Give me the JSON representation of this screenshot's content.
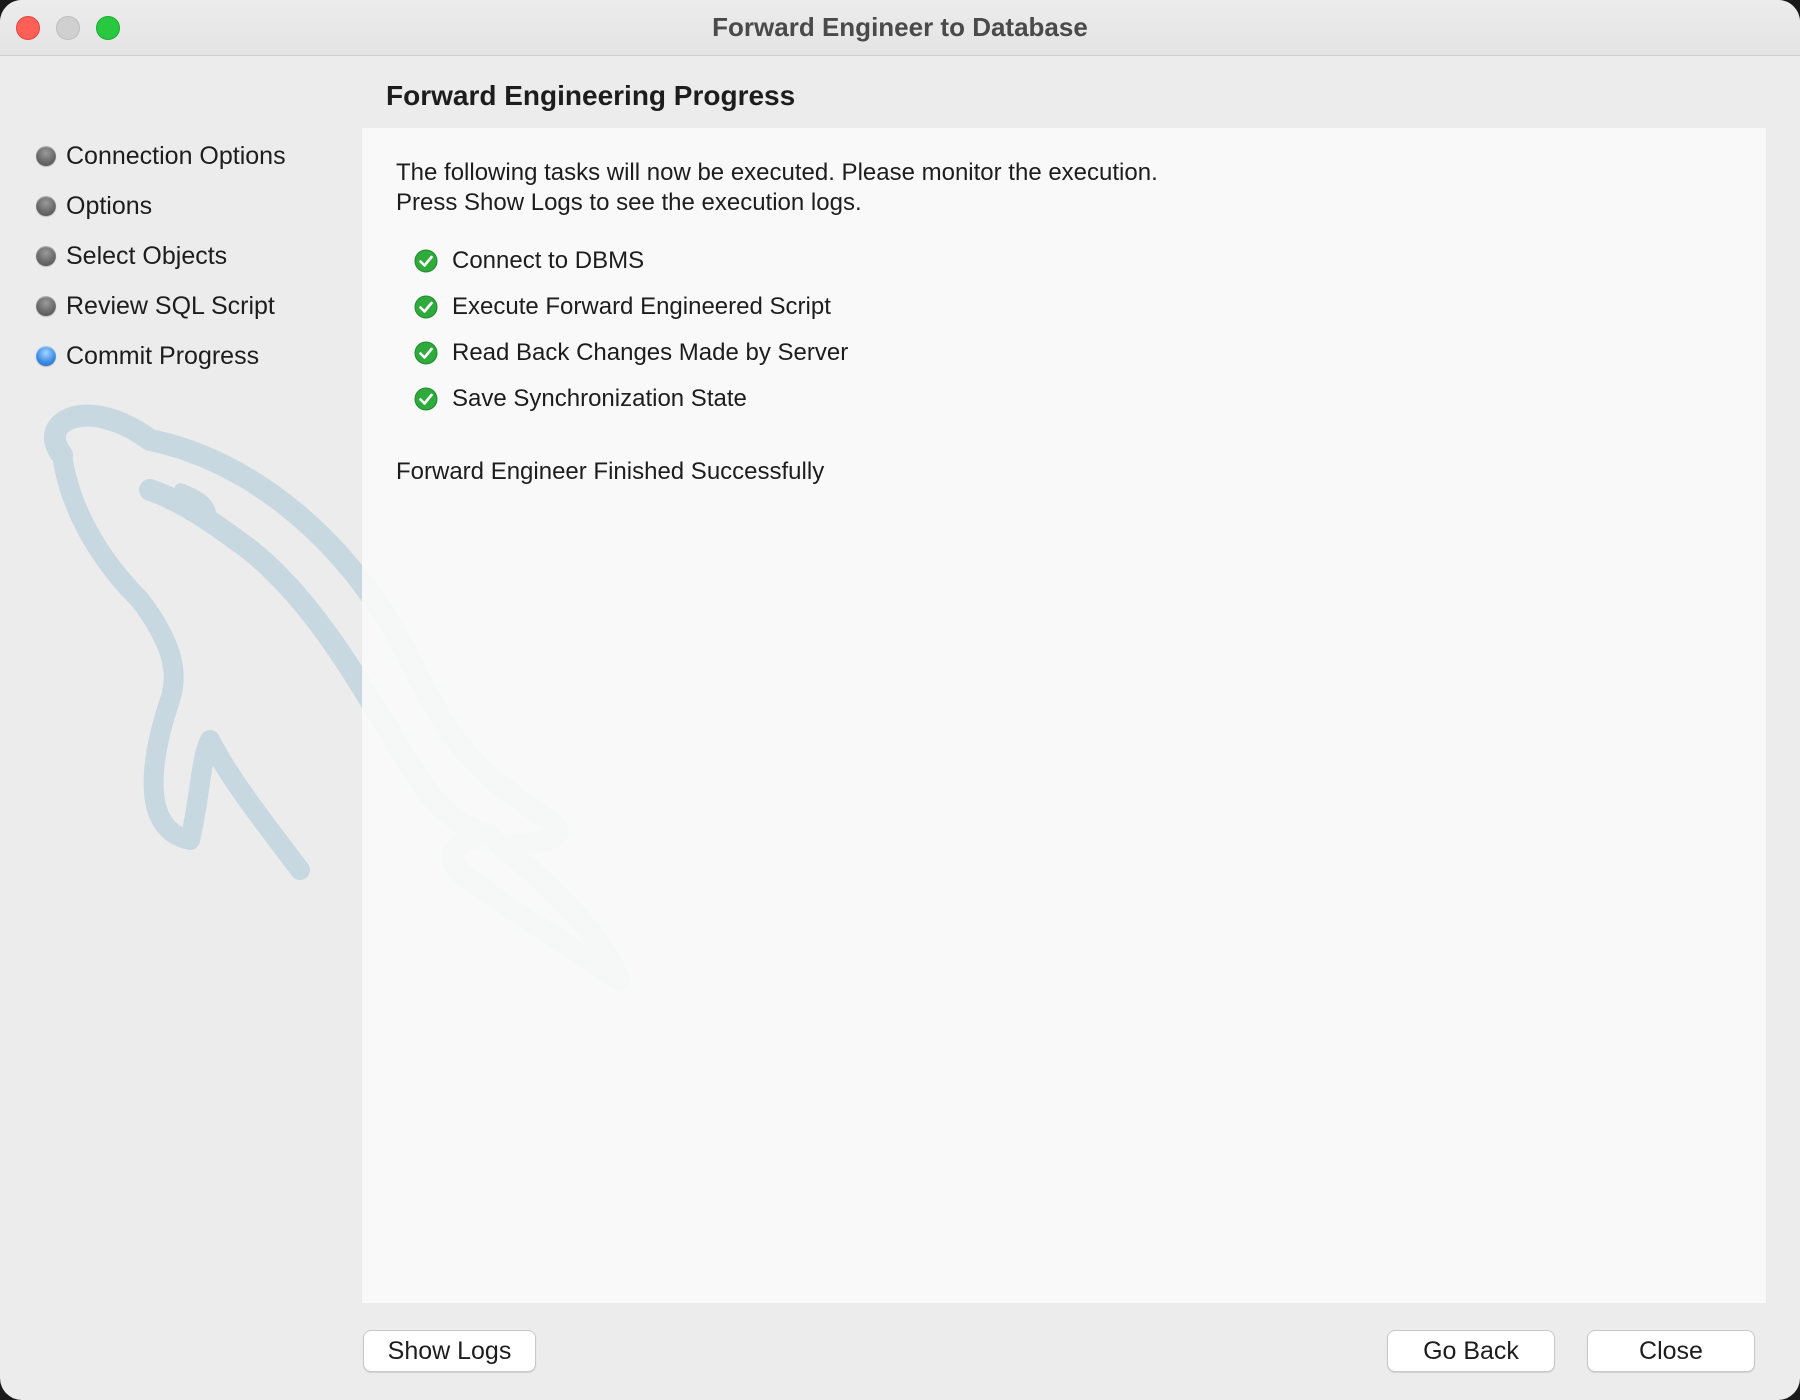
{
  "window": {
    "title": "Forward Engineer to Database"
  },
  "sidebar": {
    "steps": [
      {
        "label": "Connection Options",
        "state": "done"
      },
      {
        "label": "Options",
        "state": "done"
      },
      {
        "label": "Select Objects",
        "state": "done"
      },
      {
        "label": "Review SQL Script",
        "state": "done"
      },
      {
        "label": "Commit Progress",
        "state": "active"
      }
    ]
  },
  "main": {
    "title": "Forward Engineering Progress",
    "intro_line1": "The following tasks will now be executed. Please monitor the execution.",
    "intro_line2": "Press Show Logs to see the execution logs.",
    "tasks": [
      {
        "label": "Connect to DBMS",
        "status": "done"
      },
      {
        "label": "Execute Forward Engineered Script",
        "status": "done"
      },
      {
        "label": "Read Back Changes Made by Server",
        "status": "done"
      },
      {
        "label": "Save Synchronization State",
        "status": "done"
      }
    ],
    "result": "Forward Engineer Finished Successfully"
  },
  "footer": {
    "show_logs_label": "Show Logs",
    "go_back_label": "Go Back",
    "close_label": "Close"
  },
  "colors": {
    "active_step": "#3d8fe6",
    "check_green": "#2faa3c",
    "close_traffic": "#fe5f57",
    "max_traffic": "#28c840"
  },
  "icons": {
    "task_status": "check-circle-icon",
    "watermark": "dolphin-logo"
  }
}
